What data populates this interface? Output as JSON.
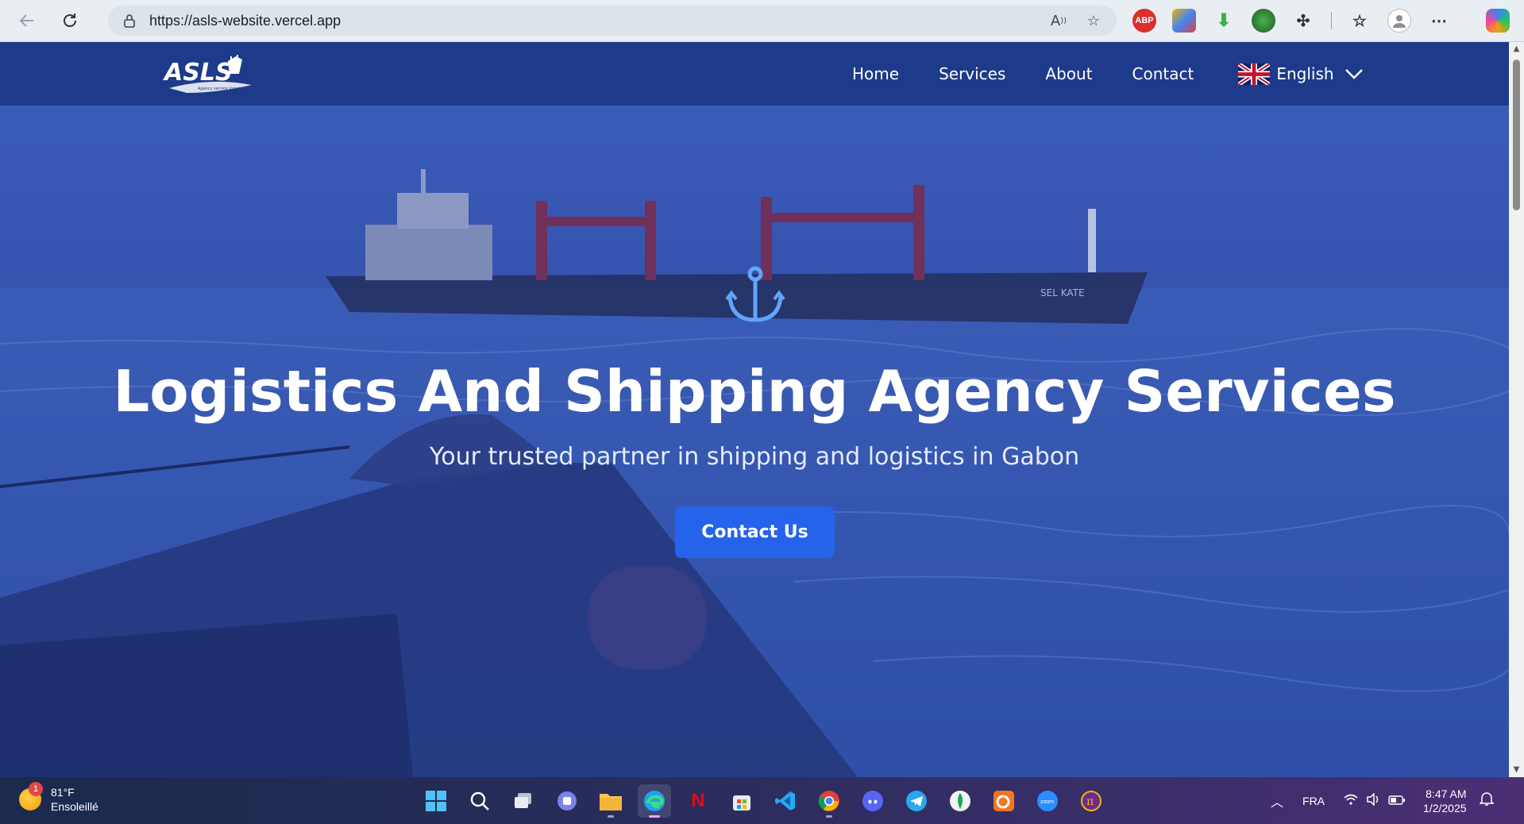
{
  "browser": {
    "url": "https://asls-website.vercel.app"
  },
  "site": {
    "logo_text": "ASLS",
    "logo_tagline": "Agency service logistic and Shipping",
    "nav": {
      "home": "Home",
      "services": "Services",
      "about": "About",
      "contact": "Contact",
      "language": "English"
    },
    "hero": {
      "title": "Logistics And Shipping Agency Services",
      "subtitle": "Your trusted partner in shipping and logistics in Gabon",
      "cta": "Contact Us",
      "ship_name": "SEL KATE"
    },
    "colors": {
      "nav_bg": "#1e3a8a",
      "cta_bg": "#2563eb",
      "anchor": "#60a5fa"
    }
  },
  "taskbar": {
    "weather_temp": "81°F",
    "weather_desc": "Ensoleillé",
    "weather_badge": "1",
    "language": "FRA",
    "time": "8:47 AM",
    "date": "1/2/2025"
  }
}
